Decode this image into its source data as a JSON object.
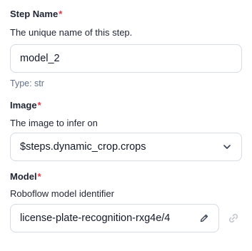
{
  "step_name": {
    "label": "Step Name",
    "required_mark": "*",
    "description": "The unique name of this step.",
    "value": "model_2",
    "type_hint": "Type: str"
  },
  "image": {
    "label": "Image",
    "required_mark": "*",
    "description": "The image to infer on",
    "selected": "$steps.dynamic_crop.crops",
    "icon": "chevron-down-icon"
  },
  "model": {
    "label": "Model",
    "required_mark": "*",
    "description": "Roboflow model identifier",
    "value": "license-plate-recognition-rxg4e/4",
    "edit_icon": "pencil-icon",
    "link_icon": "link-icon"
  },
  "colors": {
    "required": "#e23744",
    "border": "#d7dbe2",
    "muted": "#667085",
    "icon_disabled": "#c4c8cf"
  }
}
